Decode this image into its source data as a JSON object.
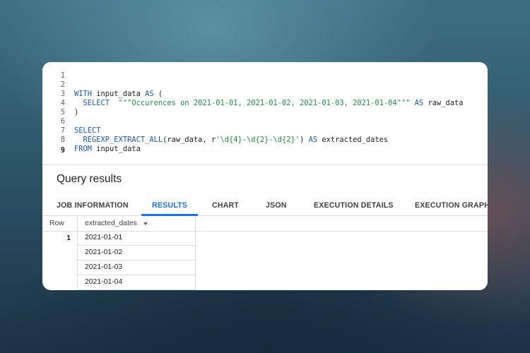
{
  "editor": {
    "lines": [
      {
        "num": "1"
      },
      {
        "num": "2",
        "tokens": [
          [
            "kw",
            "WITH "
          ],
          [
            "id",
            "input_data "
          ],
          [
            "kw",
            "AS"
          ],
          [
            "id",
            " ("
          ]
        ]
      },
      {
        "num": "3",
        "tokens": [
          [
            "id",
            "  "
          ],
          [
            "kw",
            "SELECT"
          ],
          [
            "id",
            "  "
          ],
          [
            "str",
            "\"\"\"Occurences on 2021-01-01, 2021-01-02, 2021-01-03, 2021-01-04\"\"\""
          ],
          [
            "id",
            " "
          ],
          [
            "kw",
            "AS"
          ],
          [
            "id",
            " raw_data"
          ]
        ]
      },
      {
        "num": "4",
        "tokens": [
          [
            "id",
            ")"
          ]
        ]
      },
      {
        "num": "5"
      },
      {
        "num": "6",
        "tokens": [
          [
            "kw",
            "SELECT"
          ]
        ]
      },
      {
        "num": "7",
        "tokens": [
          [
            "id",
            "  "
          ],
          [
            "kw",
            "REGEXP_EXTRACT_ALL"
          ],
          [
            "id",
            "(raw_data, r"
          ],
          [
            "str",
            "'\\d{4}-\\d{2}-\\d{2}'"
          ],
          [
            "id",
            ") "
          ],
          [
            "kw",
            "AS"
          ],
          [
            "id",
            " extracted_dates"
          ]
        ]
      },
      {
        "num": "8",
        "tokens": [
          [
            "kw",
            "FROM"
          ],
          [
            "id",
            " input_data"
          ]
        ]
      },
      {
        "num": "9"
      }
    ]
  },
  "results": {
    "title": "Query results",
    "tabs": [
      {
        "label": "JOB INFORMATION",
        "selected": false
      },
      {
        "label": "RESULTS",
        "selected": true
      },
      {
        "label": "CHART",
        "selected": false
      },
      {
        "label": "JSON",
        "selected": false
      },
      {
        "label": "EXECUTION DETAILS",
        "selected": false
      },
      {
        "label": "EXECUTION GRAPH",
        "selected": false
      }
    ],
    "columns": {
      "row": "Row",
      "field": "extracted_dates"
    },
    "row_number": "1",
    "values": [
      "2021-01-01",
      "2021-01-02",
      "2021-01-03",
      "2021-01-04"
    ]
  },
  "colors": {
    "keyword": "#1a57b8",
    "string": "#1e8a49",
    "accent": "#1a73e8"
  }
}
